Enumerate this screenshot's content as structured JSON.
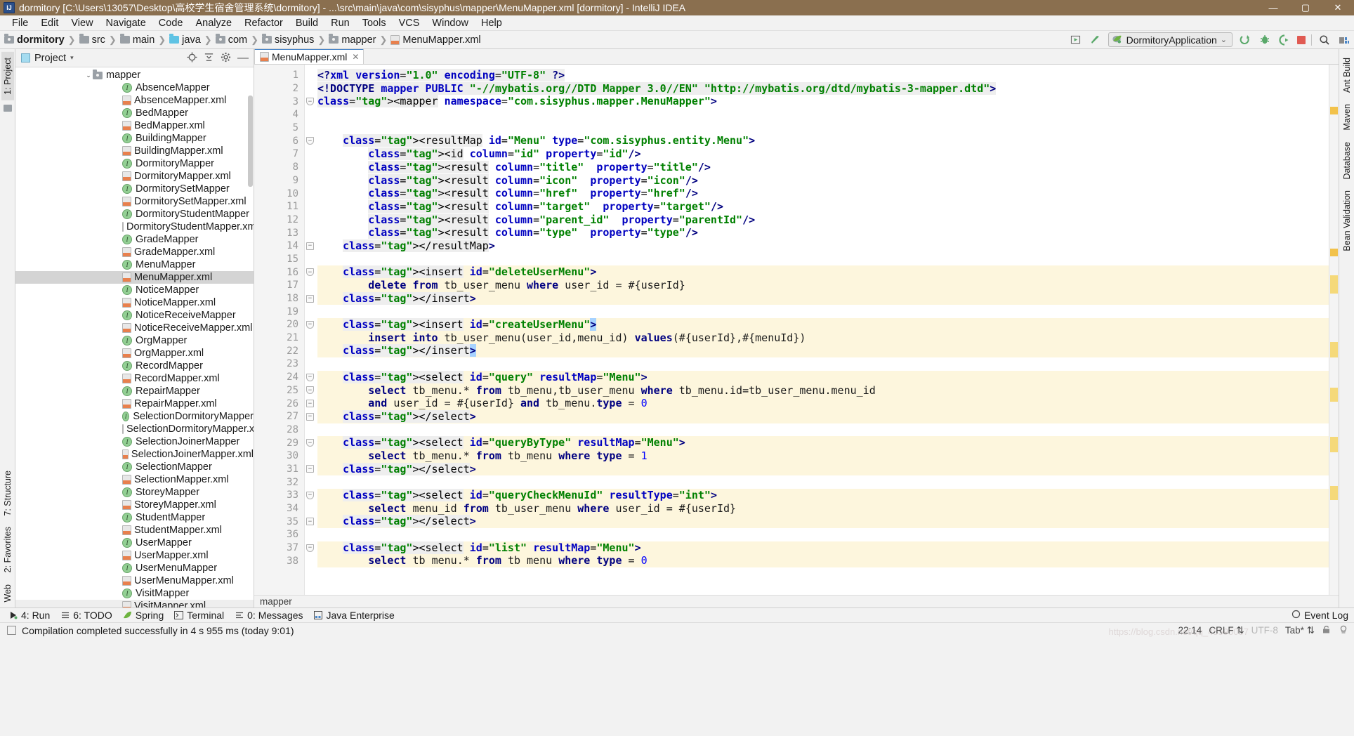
{
  "window": {
    "title": "dormitory [C:\\Users\\13057\\Desktop\\高校学生宿舍管理系统\\dormitory] - ...\\src\\main\\java\\com\\sisyphus\\mapper\\MenuMapper.xml [dormitory] - IntelliJ IDEA",
    "logo": "IJ",
    "minimize": "—",
    "maximize": "▢",
    "close": "✕"
  },
  "menu": [
    "File",
    "Edit",
    "View",
    "Navigate",
    "Code",
    "Analyze",
    "Refactor",
    "Build",
    "Run",
    "Tools",
    "VCS",
    "Window",
    "Help"
  ],
  "breadcrumb": [
    {
      "label": "dormitory",
      "icon": "folder-icon"
    },
    {
      "label": "src",
      "icon": "folder-icon"
    },
    {
      "label": "main",
      "icon": "folder-icon"
    },
    {
      "label": "java",
      "icon": "folder-blue-icon"
    },
    {
      "label": "com",
      "icon": "folder-package-icon"
    },
    {
      "label": "sisyphus",
      "icon": "folder-package-icon"
    },
    {
      "label": "mapper",
      "icon": "folder-package-icon"
    },
    {
      "label": "MenuMapper.xml",
      "icon": "xml-file-icon"
    }
  ],
  "toolbar": {
    "run_config": "DormitoryApplication",
    "dropdown_caret": "⌄",
    "icons": [
      "build-icon",
      "hammer-icon",
      "run-icon",
      "debug-icon",
      "coverage-icon",
      "stop-icon",
      "search-icon",
      "layout-icon"
    ]
  },
  "project_panel": {
    "title": "Project",
    "caret": "▾",
    "actions": [
      "locate-icon",
      "collapse-all-icon",
      "gear-icon",
      "hide-icon"
    ],
    "tree": [
      {
        "label": "mapper",
        "type": "folder",
        "depth": 0,
        "expanded": true
      },
      {
        "label": "AbsenceMapper",
        "type": "interface",
        "depth": 1
      },
      {
        "label": "AbsenceMapper.xml",
        "type": "xml",
        "depth": 1
      },
      {
        "label": "BedMapper",
        "type": "interface",
        "depth": 1
      },
      {
        "label": "BedMapper.xml",
        "type": "xml",
        "depth": 1
      },
      {
        "label": "BuildingMapper",
        "type": "interface",
        "depth": 1
      },
      {
        "label": "BuildingMapper.xml",
        "type": "xml",
        "depth": 1
      },
      {
        "label": "DormitoryMapper",
        "type": "interface",
        "depth": 1
      },
      {
        "label": "DormitoryMapper.xml",
        "type": "xml",
        "depth": 1
      },
      {
        "label": "DormitorySetMapper",
        "type": "interface",
        "depth": 1
      },
      {
        "label": "DormitorySetMapper.xml",
        "type": "xml",
        "depth": 1
      },
      {
        "label": "DormitoryStudentMapper",
        "type": "interface",
        "depth": 1
      },
      {
        "label": "DormitoryStudentMapper.xml",
        "type": "xml",
        "depth": 1
      },
      {
        "label": "GradeMapper",
        "type": "interface",
        "depth": 1
      },
      {
        "label": "GradeMapper.xml",
        "type": "xml",
        "depth": 1
      },
      {
        "label": "MenuMapper",
        "type": "interface",
        "depth": 1
      },
      {
        "label": "MenuMapper.xml",
        "type": "xml",
        "depth": 1,
        "selected": true
      },
      {
        "label": "NoticeMapper",
        "type": "interface",
        "depth": 1
      },
      {
        "label": "NoticeMapper.xml",
        "type": "xml",
        "depth": 1
      },
      {
        "label": "NoticeReceiveMapper",
        "type": "interface",
        "depth": 1
      },
      {
        "label": "NoticeReceiveMapper.xml",
        "type": "xml",
        "depth": 1
      },
      {
        "label": "OrgMapper",
        "type": "interface",
        "depth": 1
      },
      {
        "label": "OrgMapper.xml",
        "type": "xml",
        "depth": 1
      },
      {
        "label": "RecordMapper",
        "type": "interface",
        "depth": 1
      },
      {
        "label": "RecordMapper.xml",
        "type": "xml",
        "depth": 1
      },
      {
        "label": "RepairMapper",
        "type": "interface",
        "depth": 1
      },
      {
        "label": "RepairMapper.xml",
        "type": "xml",
        "depth": 1
      },
      {
        "label": "SelectionDormitoryMapper",
        "type": "interface",
        "depth": 1
      },
      {
        "label": "SelectionDormitoryMapper.xml",
        "type": "xml",
        "depth": 1
      },
      {
        "label": "SelectionJoinerMapper",
        "type": "interface",
        "depth": 1
      },
      {
        "label": "SelectionJoinerMapper.xml",
        "type": "xml",
        "depth": 1
      },
      {
        "label": "SelectionMapper",
        "type": "interface",
        "depth": 1
      },
      {
        "label": "SelectionMapper.xml",
        "type": "xml",
        "depth": 1
      },
      {
        "label": "StoreyMapper",
        "type": "interface",
        "depth": 1
      },
      {
        "label": "StoreyMapper.xml",
        "type": "xml",
        "depth": 1
      },
      {
        "label": "StudentMapper",
        "type": "interface",
        "depth": 1
      },
      {
        "label": "StudentMapper.xml",
        "type": "xml",
        "depth": 1
      },
      {
        "label": "UserMapper",
        "type": "interface",
        "depth": 1
      },
      {
        "label": "UserMapper.xml",
        "type": "xml",
        "depth": 1
      },
      {
        "label": "UserMenuMapper",
        "type": "interface",
        "depth": 1
      },
      {
        "label": "UserMenuMapper.xml",
        "type": "xml",
        "depth": 1
      },
      {
        "label": "VisitMapper",
        "type": "interface",
        "depth": 1
      },
      {
        "label": "VisitMapper.xml",
        "type": "xml",
        "depth": 1,
        "hover": true
      }
    ]
  },
  "left_tool_tabs": [
    {
      "label": "1: Project",
      "active": true
    }
  ],
  "left_tool_tabs_bottom": [
    {
      "label": "7: Structure"
    },
    {
      "label": "2: Favorites"
    },
    {
      "label": "Web"
    }
  ],
  "right_tool_tabs": [
    "Ant Build",
    "Maven",
    "Database",
    "Bean Validation"
  ],
  "editor": {
    "tab": {
      "label": "MenuMapper.xml",
      "close": "✕"
    },
    "footer_breadcrumb": "mapper",
    "lines": [
      {
        "n": 1,
        "text": "<?xml version=\"1.0\" encoding=\"UTF-8\" ?>"
      },
      {
        "n": 2,
        "text": "<!DOCTYPE mapper PUBLIC \"-//mybatis.org//DTD Mapper 3.0//EN\" \"http://mybatis.org/dtd/mybatis-3-mapper.dtd\">"
      },
      {
        "n": 3,
        "text": "<mapper namespace=\"com.sisyphus.mapper.MenuMapper\">"
      },
      {
        "n": 4,
        "text": ""
      },
      {
        "n": 5,
        "text": ""
      },
      {
        "n": 6,
        "text": "    <resultMap id=\"Menu\" type=\"com.sisyphus.entity.Menu\">"
      },
      {
        "n": 7,
        "text": "        <id column=\"id\" property=\"id\"/>"
      },
      {
        "n": 8,
        "text": "        <result column=\"title\"  property=\"title\"/>"
      },
      {
        "n": 9,
        "text": "        <result column=\"icon\"  property=\"icon\"/>"
      },
      {
        "n": 10,
        "text": "        <result column=\"href\"  property=\"href\"/>"
      },
      {
        "n": 11,
        "text": "        <result column=\"target\"  property=\"target\"/>"
      },
      {
        "n": 12,
        "text": "        <result column=\"parent_id\"  property=\"parentId\"/>"
      },
      {
        "n": 13,
        "text": "        <result column=\"type\"  property=\"type\"/>"
      },
      {
        "n": 14,
        "text": "    </resultMap>"
      },
      {
        "n": 15,
        "text": ""
      },
      {
        "n": 16,
        "text": "    <insert id=\"deleteUserMenu\">"
      },
      {
        "n": 17,
        "text": "        delete from tb_user_menu where user_id = #{userId}"
      },
      {
        "n": 18,
        "text": "    </insert>"
      },
      {
        "n": 19,
        "text": ""
      },
      {
        "n": 20,
        "text": "    <insert id=\"createUserMenu\">"
      },
      {
        "n": 21,
        "text": "        insert into tb_user_menu(user_id,menu_id) values(#{userId},#{menuId})"
      },
      {
        "n": 22,
        "text": "    </insert>"
      },
      {
        "n": 23,
        "text": ""
      },
      {
        "n": 24,
        "text": "    <select id=\"query\" resultMap=\"Menu\">"
      },
      {
        "n": 25,
        "text": "        select tb_menu.* from tb_menu,tb_user_menu where tb_menu.id=tb_user_menu.menu_id"
      },
      {
        "n": 26,
        "text": "        and user_id = #{userId} and tb_menu.type = 0"
      },
      {
        "n": 27,
        "text": "    </select>"
      },
      {
        "n": 28,
        "text": ""
      },
      {
        "n": 29,
        "text": "    <select id=\"queryByType\" resultMap=\"Menu\">"
      },
      {
        "n": 30,
        "text": "        select tb_menu.* from tb_menu where type = 1"
      },
      {
        "n": 31,
        "text": "    </select>"
      },
      {
        "n": 32,
        "text": ""
      },
      {
        "n": 33,
        "text": "    <select id=\"queryCheckMenuId\" resultType=\"int\">"
      },
      {
        "n": 34,
        "text": "        select menu_id from tb_user_menu where user_id = #{userId}"
      },
      {
        "n": 35,
        "text": "    </select>"
      },
      {
        "n": 36,
        "text": ""
      },
      {
        "n": 37,
        "text": "    <select id=\"list\" resultMap=\"Menu\">"
      },
      {
        "n": 38,
        "text": "        select tb menu.* from tb menu where type = 0"
      }
    ]
  },
  "tool_window_bar": {
    "buttons": [
      {
        "label": "4: Run",
        "underline": "4",
        "icon": "run-icon"
      },
      {
        "label": "6: TODO",
        "underline": "6",
        "icon": "todo-icon"
      },
      {
        "label": "Spring",
        "icon": "spring-leaf-icon"
      },
      {
        "label": "Terminal",
        "icon": "terminal-icon"
      },
      {
        "label": "0: Messages",
        "underline": "0",
        "icon": "messages-icon"
      },
      {
        "label": "Java Enterprise",
        "icon": "java-enterprise-icon"
      }
    ],
    "event_log": "Event Log"
  },
  "status_bar": {
    "message": "Compilation completed successfully in 4 s 955 ms (today 9:01)",
    "caret_position": "22:14",
    "line_separator": "CRLF",
    "encoding": "UTF-8",
    "indent": "Tab*",
    "icons": [
      "lock-icon",
      "inspector-icon"
    ]
  }
}
